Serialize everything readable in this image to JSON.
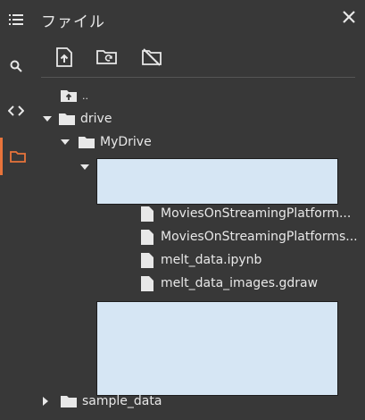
{
  "panel": {
    "title": "ファイル",
    "close_icon": "close-icon"
  },
  "rail": {
    "items": [
      {
        "icon": "list-icon"
      },
      {
        "icon": "search-icon"
      },
      {
        "icon": "code-icon"
      },
      {
        "icon": "folder-icon",
        "active": true
      }
    ],
    "accent": "#e8743b"
  },
  "toolbar": {
    "buttons": [
      {
        "icon": "upload-icon"
      },
      {
        "icon": "refresh-folder-icon"
      },
      {
        "icon": "unmount-drive-icon"
      }
    ]
  },
  "tree": {
    "parent": "..",
    "drive": "drive",
    "mydrive": "MyDrive",
    "files": [
      "MoviesOnStreamingPlatform...",
      "MoviesOnStreamingPlatforms...",
      "melt_data.ipynb",
      "melt_data_images.gdraw"
    ],
    "sample_data": "sample_data"
  },
  "colors": {
    "background": "#383838",
    "text": "#e8e8e8",
    "redaction": "#d6e6f4"
  }
}
